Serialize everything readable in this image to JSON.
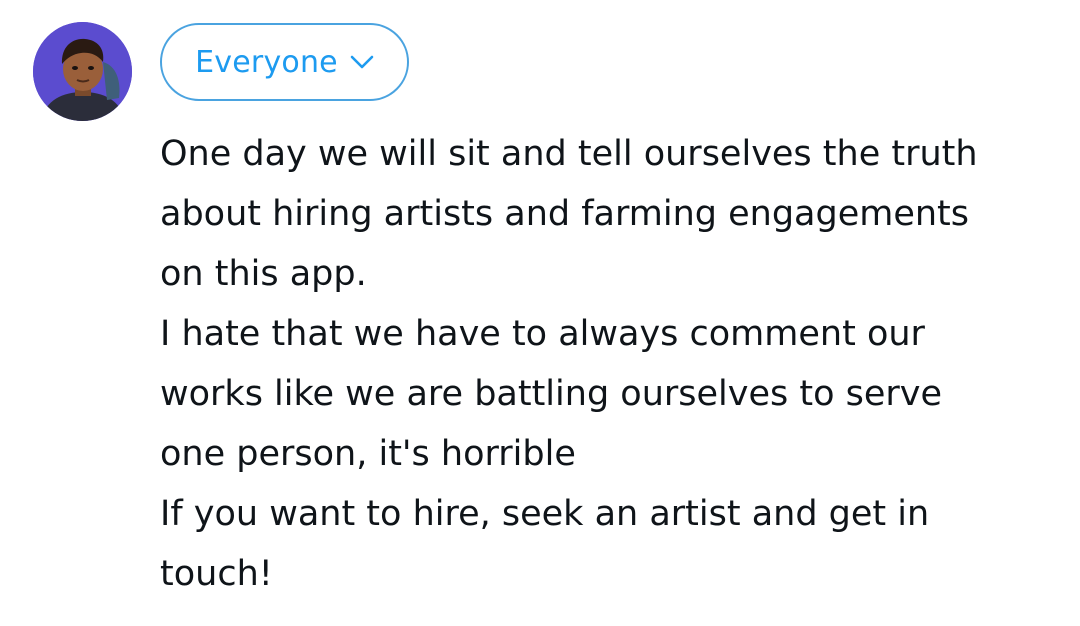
{
  "avatar": {
    "icon": "user-avatar-illustration",
    "background_color": "#5b4ccf"
  },
  "audience": {
    "label": "Everyone",
    "icon": "chevron-down-icon",
    "accent_color": "#1d9bf0"
  },
  "post": {
    "text": "One day we will sit and tell ourselves the truth\nabout hiring artists and farming engagements\non this app.\nI hate that we have to always comment our\nworks like we are battling ourselves to serve\none person, it's horrible\nIf you want to hire, seek an artist and get in\ntouch!"
  }
}
